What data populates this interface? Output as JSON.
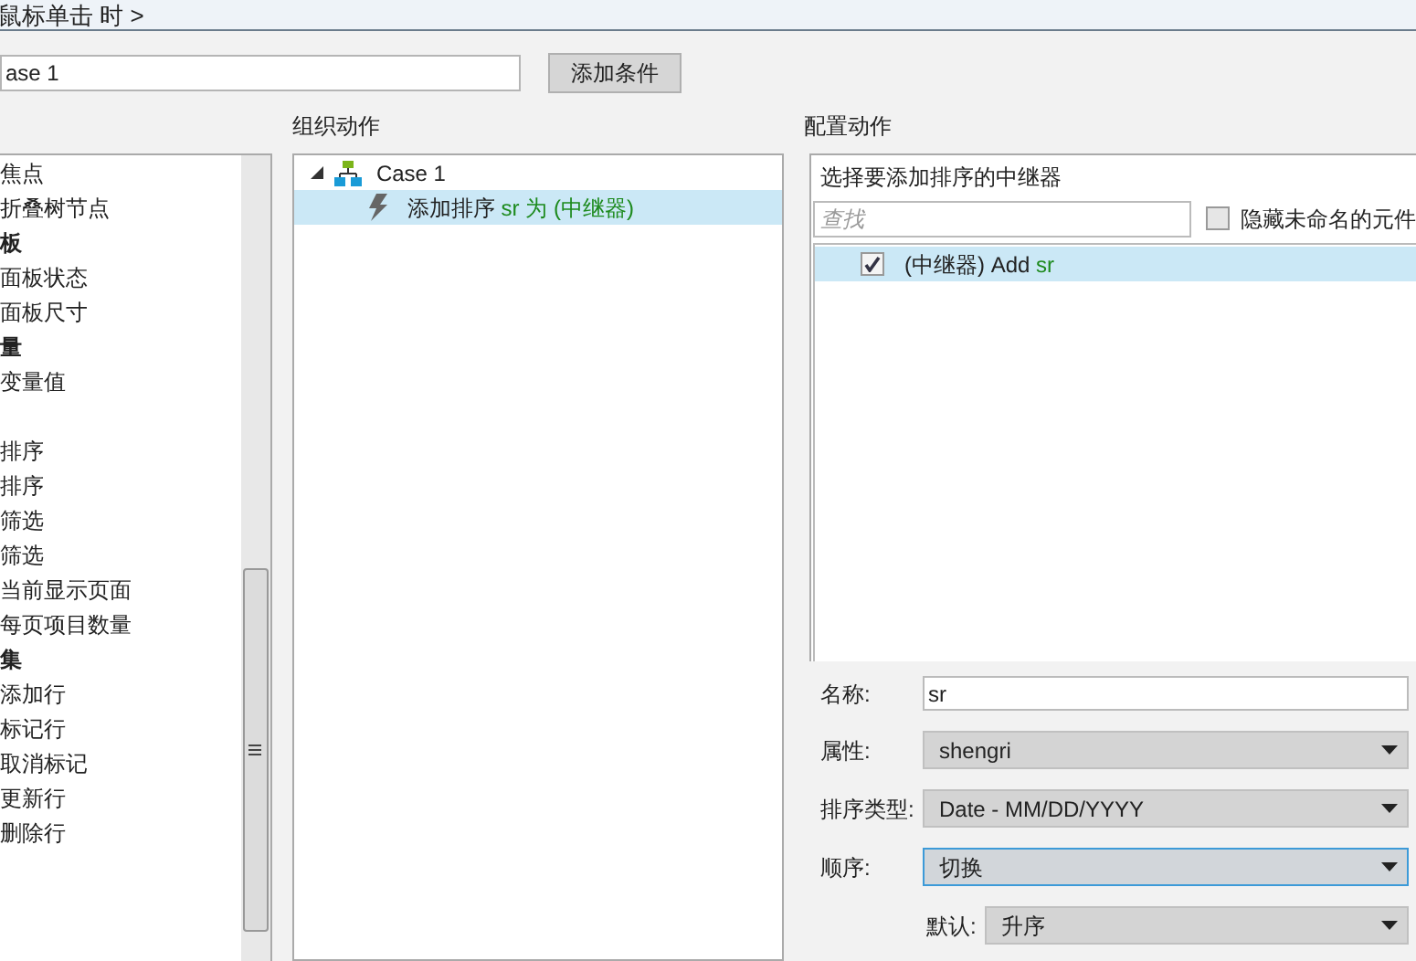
{
  "header": {
    "title": "鼠标单击 时 >"
  },
  "case_field": {
    "value": "ase 1"
  },
  "add_condition_button": "添加条件",
  "actions_list": {
    "items": [
      {
        "label": "焦点",
        "kind": "item"
      },
      {
        "label": "折叠树节点",
        "kind": "item"
      },
      {
        "label": "板",
        "kind": "group"
      },
      {
        "label": "面板状态",
        "kind": "item"
      },
      {
        "label": "面板尺寸",
        "kind": "item"
      },
      {
        "label": "量",
        "kind": "group"
      },
      {
        "label": "变量值",
        "kind": "item"
      },
      {
        "kind": "blank"
      },
      {
        "label": "排序",
        "kind": "item"
      },
      {
        "label": "排序",
        "kind": "item"
      },
      {
        "label": "筛选",
        "kind": "item"
      },
      {
        "label": "筛选",
        "kind": "item"
      },
      {
        "label": "当前显示页面",
        "kind": "item"
      },
      {
        "label": "每页项目数量",
        "kind": "item"
      },
      {
        "label": "集",
        "kind": "group"
      },
      {
        "label": "添加行",
        "kind": "item"
      },
      {
        "label": "标记行",
        "kind": "item"
      },
      {
        "label": "取消标记",
        "kind": "item"
      },
      {
        "label": "更新行",
        "kind": "item"
      },
      {
        "label": "删除行",
        "kind": "item"
      }
    ]
  },
  "organize": {
    "title": "组织动作",
    "case": {
      "label": "Case 1",
      "expanded": true,
      "children": [
        {
          "label": "添加排序",
          "highlight": "sr 为 (中继器)",
          "selected": true
        }
      ]
    }
  },
  "configure": {
    "title": "配置动作",
    "prompt": "选择要添加排序的中继器",
    "search": {
      "placeholder": "查找"
    },
    "hide_unnamed": {
      "label": "隐藏未命名的元件",
      "checked": false
    },
    "repeaters": [
      {
        "label": "(中继器) Add",
        "highlight": "sr",
        "checked": true,
        "selected": true
      }
    ],
    "fields": [
      {
        "label": "名称:",
        "value": "sr",
        "kind": "text",
        "focused": false
      },
      {
        "label": "属性:",
        "value": "shengri",
        "kind": "select",
        "focused": false
      },
      {
        "label": "排序类型:",
        "value": "Date - MM/DD/YYYY",
        "kind": "select",
        "focused": false
      },
      {
        "label": "顺序:",
        "value": "切换",
        "kind": "select",
        "focused": true
      },
      {
        "label": "默认:",
        "value": "升序",
        "kind": "subselect",
        "focused": false
      }
    ]
  }
}
